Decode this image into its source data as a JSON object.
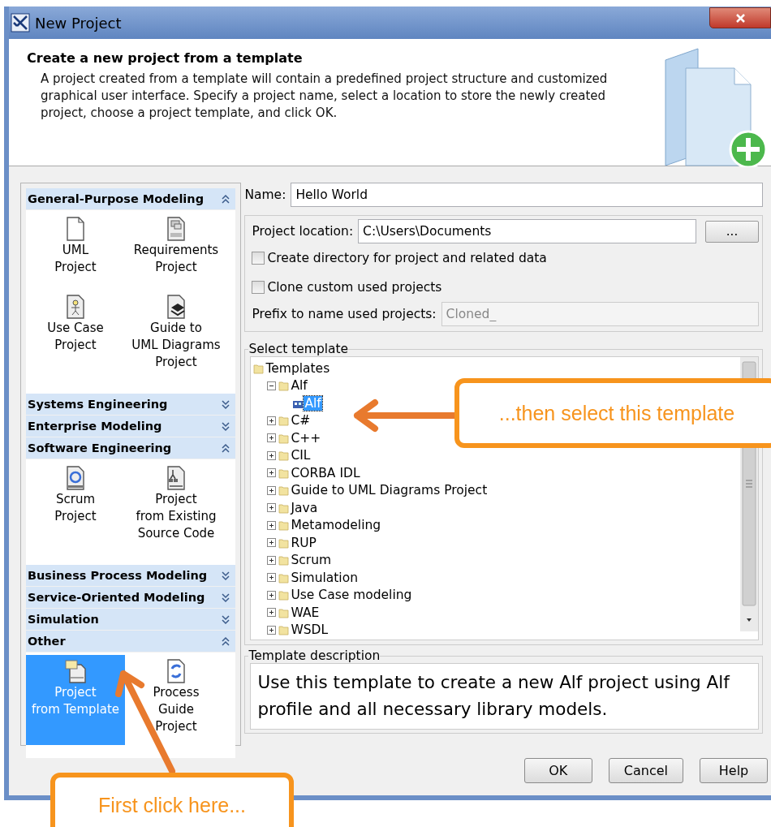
{
  "window": {
    "title": "New Project"
  },
  "header": {
    "title": "Create a new project from a template",
    "description": "A project created from a template will contain a predefined project structure and customized graphical user interface. Specify a project name, select a location to store the newly created project, choose a project template, and click OK."
  },
  "categories": [
    {
      "label": "General-Purpose Modeling",
      "expanded": true,
      "items": [
        {
          "label": "UML\nProject",
          "kind": "document",
          "selected": false
        },
        {
          "label": "Requirements\nProject",
          "kind": "requirements",
          "selected": false
        },
        {
          "label": "Use Case\nProject",
          "kind": "usecase",
          "selected": false
        },
        {
          "label": "Guide to\nUML Diagrams\nProject",
          "kind": "guide",
          "selected": false
        }
      ]
    },
    {
      "label": "Systems Engineering",
      "expanded": false
    },
    {
      "label": "Enterprise Modeling",
      "expanded": false
    },
    {
      "label": "Software Engineering",
      "expanded": true,
      "items": [
        {
          "label": "Scrum\nProject",
          "kind": "scrum",
          "selected": false
        },
        {
          "label": "Project\nfrom Existing\nSource Code",
          "kind": "source",
          "selected": false
        }
      ]
    },
    {
      "label": "Business Process Modeling",
      "expanded": false
    },
    {
      "label": "Service-Oriented Modeling",
      "expanded": false
    },
    {
      "label": "Simulation",
      "expanded": false
    },
    {
      "label": "Other",
      "expanded": true,
      "items": [
        {
          "label": "Project\nfrom Template",
          "kind": "template",
          "selected": true
        },
        {
          "label": "Process\nGuide\nProject",
          "kind": "process",
          "selected": false
        }
      ]
    }
  ],
  "form": {
    "name": {
      "label": "Name:",
      "value": "Hello World"
    },
    "location": {
      "label": "Project location:",
      "value": "C:\\Users\\Documents",
      "browse": "..."
    },
    "checkboxes": [
      {
        "label": "Create directory for project and related data",
        "checked": false
      },
      {
        "label": "Clone custom used projects",
        "checked": false
      }
    ],
    "prefix": {
      "label": "Prefix to name used projects:",
      "value": "Cloned_",
      "disabled": true
    }
  },
  "template_tree": {
    "title": "Select template",
    "root": {
      "label": "Templates",
      "kind": "folder",
      "selected": false,
      "children": [
        {
          "label": "Alf",
          "kind": "folder",
          "expanded": true,
          "selected": false,
          "children": [
            {
              "label": "Alf",
              "kind": "template",
              "selected": true
            }
          ]
        },
        {
          "label": "C#",
          "kind": "folder",
          "expanded": false,
          "selected": false
        },
        {
          "label": "C++",
          "kind": "folder",
          "expanded": false,
          "selected": false
        },
        {
          "label": "CIL",
          "kind": "folder",
          "expanded": false,
          "selected": false
        },
        {
          "label": "CORBA IDL",
          "kind": "folder",
          "expanded": false,
          "selected": false
        },
        {
          "label": "Guide to UML Diagrams Project",
          "kind": "folder",
          "expanded": false,
          "selected": false
        },
        {
          "label": "Java",
          "kind": "folder",
          "expanded": false,
          "selected": false
        },
        {
          "label": "Metamodeling",
          "kind": "folder",
          "expanded": false,
          "selected": false
        },
        {
          "label": "RUP",
          "kind": "folder",
          "expanded": false,
          "selected": false
        },
        {
          "label": "Scrum",
          "kind": "folder",
          "expanded": false,
          "selected": false
        },
        {
          "label": "Simulation",
          "kind": "folder",
          "expanded": false,
          "selected": false
        },
        {
          "label": "Use Case modeling",
          "kind": "folder",
          "expanded": false,
          "selected": false
        },
        {
          "label": "WAE",
          "kind": "folder",
          "expanded": false,
          "selected": false
        },
        {
          "label": "WSDL",
          "kind": "folder",
          "expanded": false,
          "selected": false
        }
      ]
    }
  },
  "template_description": {
    "title": "Template description",
    "text": "Use this template to create a new Alf project using Alf profile and all necessary library models."
  },
  "buttons": [
    "OK",
    "Cancel",
    "Help"
  ],
  "callouts": [
    {
      "text": "...then select this template"
    },
    {
      "text": "First click here..."
    }
  ]
}
